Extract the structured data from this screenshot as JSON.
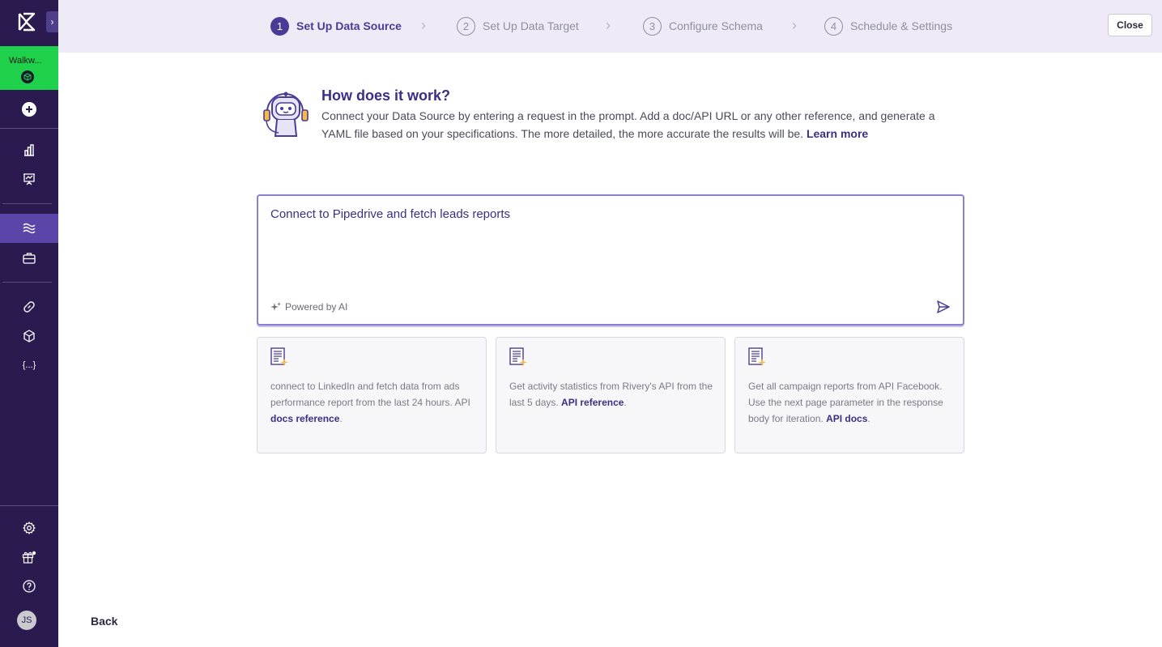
{
  "sidebar": {
    "workspace_name": "Walkw...",
    "avatar_initials": "JS",
    "expand_glyph": "›",
    "items": [
      {
        "name": "sidebar-item-create",
        "icon": "plus-circle-icon"
      },
      {
        "name": "sidebar-item-dashboard",
        "icon": "bar-chart-icon"
      },
      {
        "name": "sidebar-item-monitoring",
        "icon": "presentation-icon"
      },
      {
        "name": "sidebar-item-rivers",
        "icon": "waves-icon",
        "active": true
      },
      {
        "name": "sidebar-item-kits",
        "icon": "briefcase-icon"
      },
      {
        "name": "sidebar-item-connections",
        "icon": "link-icon"
      },
      {
        "name": "sidebar-item-blueprints",
        "icon": "cube-icon"
      },
      {
        "name": "sidebar-item-variables",
        "icon": "braces-icon"
      },
      {
        "name": "sidebar-item-settings",
        "icon": "gear-icon"
      },
      {
        "name": "sidebar-item-whats-new",
        "icon": "gift-icon"
      },
      {
        "name": "sidebar-item-help",
        "icon": "help-icon"
      }
    ],
    "variables_glyph": "{...}"
  },
  "wizard": {
    "steps": [
      {
        "number": "1",
        "label": "Set Up Data Source",
        "active": true
      },
      {
        "number": "2",
        "label": "Set Up Data Target",
        "active": false
      },
      {
        "number": "3",
        "label": "Configure Schema",
        "active": false
      },
      {
        "number": "4",
        "label": "Schedule & Settings",
        "active": false
      }
    ],
    "chevron": "›",
    "close_label": "Close"
  },
  "info": {
    "title": "How does it work?",
    "text": "Connect your Data Source by entering a request in the prompt. Add a doc/API URL or any other reference, and generate a YAML file based on your specifications. The more detailed, the more accurate the results will be.",
    "link": "Learn more"
  },
  "prompt": {
    "value": "Connect to Pipedrive and fetch leads reports",
    "powered_by": "Powered by AI"
  },
  "examples": [
    {
      "text": "connect to LinkedIn and fetch data from ads performance report from the last 24 hours. API",
      "link": "docs reference",
      "suffix": "."
    },
    {
      "text": "Get activity statistics from Rivery's API from the last 5 days.",
      "link": "API reference",
      "suffix": "."
    },
    {
      "text": "Get all campaign reports from API Facebook. Use the next page parameter in the response body for iteration.",
      "link": "API docs",
      "suffix": "."
    }
  ],
  "footer": {
    "back_label": "Back"
  },
  "colors": {
    "sidebar_bg": "#2a1a4f",
    "accent": "#4a3c96",
    "workspace_green": "#1fd14a"
  }
}
